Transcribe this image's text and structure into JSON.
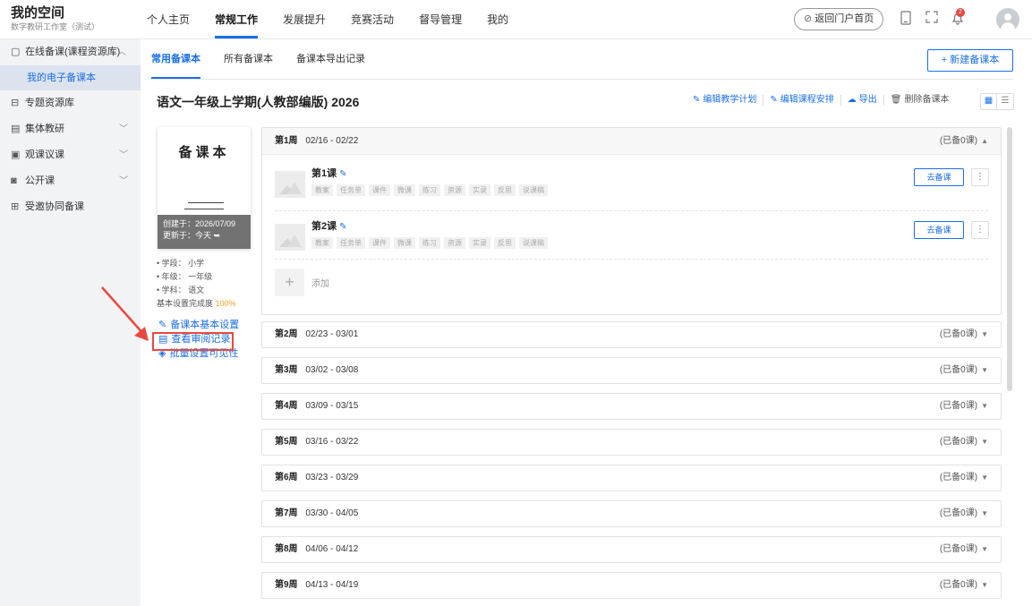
{
  "app": {
    "title": "我的空间",
    "subtitle": "数字教研工作室（测试）"
  },
  "topnav": {
    "items": [
      "个人主页",
      "常规工作",
      "发展提升",
      "竞赛活动",
      "督导管理",
      "我的"
    ],
    "active_index": 1,
    "portal_button": "返回门户首页",
    "notification_badge": "2"
  },
  "sidebar": {
    "items": [
      {
        "label": "在线备课(课程资源库)",
        "icon": "document-icon",
        "expanded": true
      },
      {
        "label": "专题资源库",
        "icon": "folder-icon"
      },
      {
        "label": "集体教研",
        "icon": "board-icon",
        "expandable": true
      },
      {
        "label": "观课议课",
        "icon": "classroom-icon",
        "expandable": true
      },
      {
        "label": "公开课",
        "icon": "screen-icon",
        "expandable": true
      },
      {
        "label": "受邀协同备课",
        "icon": "group-icon"
      }
    ],
    "sub_item": "我的电子备课本"
  },
  "tabs": {
    "items": [
      "常用备课本",
      "所有备课本",
      "备课本导出记录"
    ],
    "active_index": 0,
    "new_button": "+ 新建备课本"
  },
  "book": {
    "title": "语文一年级上学期(人教部编版) 2026",
    "cover_title": "备课本",
    "created": "创建于：2026/07/09",
    "updated": "更新于：今天",
    "stage": "• 学段：  小学",
    "grade": "• 年级：  一年级",
    "subject": "• 学科：  语文",
    "completion_label": "基本设置完成度",
    "completion_value": "100%"
  },
  "actions": {
    "edit_plan": "编辑教学计划",
    "edit_schedule": "编辑课程安排",
    "export": "导出",
    "delete": "删除备课本"
  },
  "side_links": {
    "basic_settings": "备课本基本设置",
    "review_records": "查看审阅记录",
    "batch_visibility": "批量设置可见性"
  },
  "weeks": [
    {
      "label": "第1周",
      "range": "02/16 - 02/22",
      "status": "(已备0课)",
      "expanded": true
    },
    {
      "label": "第2周",
      "range": "02/23 - 03/01",
      "status": "(已备0课)"
    },
    {
      "label": "第3周",
      "range": "03/02 - 03/08",
      "status": "(已备0课)"
    },
    {
      "label": "第4周",
      "range": "03/09 - 03/15",
      "status": "(已备0课)"
    },
    {
      "label": "第5周",
      "range": "03/16 - 03/22",
      "status": "(已备0课)"
    },
    {
      "label": "第6周",
      "range": "03/23 - 03/29",
      "status": "(已备0课)"
    },
    {
      "label": "第7周",
      "range": "03/30 - 04/05",
      "status": "(已备0课)"
    },
    {
      "label": "第8周",
      "range": "04/06 - 04/12",
      "status": "(已备0课)"
    },
    {
      "label": "第9周",
      "range": "04/13 - 04/19",
      "status": "(已备0课)"
    }
  ],
  "lessons": [
    {
      "name": "第1课",
      "button": "去备课"
    },
    {
      "name": "第2课",
      "button": "去备课"
    }
  ],
  "lesson_chips": [
    "教案",
    "任务单",
    "课件",
    "微课",
    "练习",
    "资源",
    "实录",
    "反思",
    "说课稿"
  ],
  "add_label": "添加",
  "colors": {
    "accent": "#1a6fe8",
    "highlight": "#e8483f",
    "completion": "#f0a020"
  }
}
